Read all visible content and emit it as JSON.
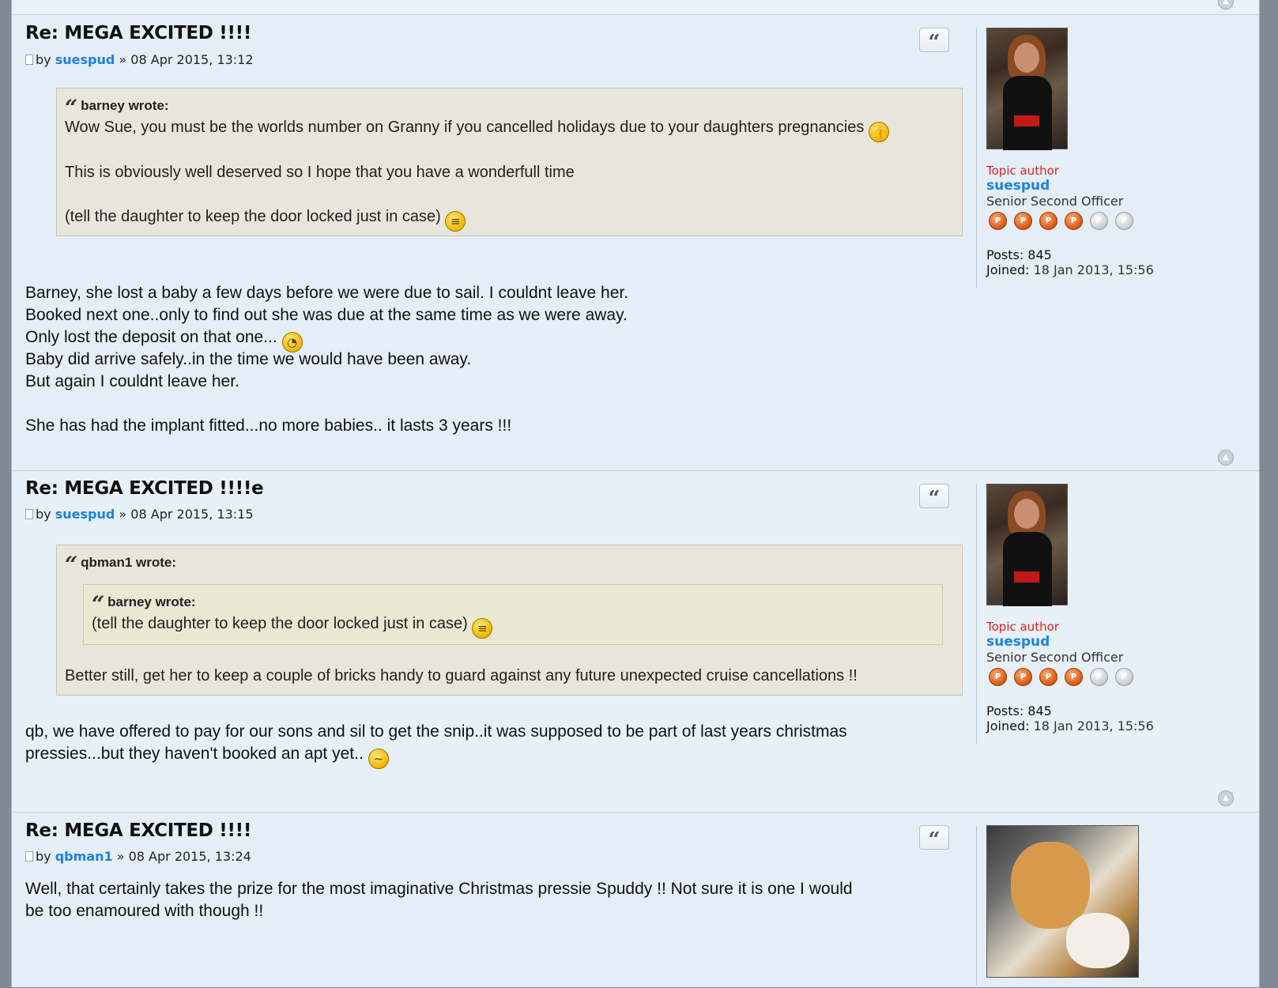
{
  "posts": [
    {
      "title": "Re: MEGA EXCITED !!!!",
      "by": "by",
      "author": "suespud",
      "date_sep": "»",
      "date": "08 Apr 2015, 13:12",
      "quote": {
        "author_line": "barney wrote:",
        "lines": [
          "Wow Sue, you must be the worlds number on Granny if you cancelled holidays due to your daughters pregnancies",
          "This is obviously well deserved so I hope that you have a wonderfull time",
          "(tell the daughter to keep the door locked just in case)"
        ]
      },
      "body": [
        "Barney, she lost a baby a few days before we were due to sail. I couldnt leave her.",
        "Booked next one..only to find out she was due at the same time as we were away.",
        "Only lost the deposit on that one...",
        "Baby did arrive safely..in the time we would have been away.",
        "But again I couldnt leave her.",
        "She has had the implant fitted...no more babies.. it lasts 3 years !!!"
      ],
      "sidebar": {
        "role": "Topic author",
        "name": "suespud",
        "rank": "Senior Second Officer",
        "posts_label": "Posts:",
        "posts": "845",
        "joined_label": "Joined:",
        "joined": "18 Jan 2013, 15:56"
      }
    },
    {
      "title": "Re: MEGA EXCITED !!!!e",
      "by": "by",
      "author": "suespud",
      "date_sep": "»",
      "date": "08 Apr 2015, 13:15",
      "quote": {
        "author_line": "qbman1 wrote:",
        "inner_author_line": "barney wrote:",
        "inner_line": "(tell the daughter to keep the door locked just in case)",
        "line": "Better still, get her to keep a couple of bricks handy to guard against any future unexpected cruise cancellations !!"
      },
      "body": [
        "qb, we have offered to pay for our sons and sil to get the snip..it was supposed to be part of last years christmas",
        "pressies...but they haven't booked an apt yet.."
      ],
      "sidebar": {
        "role": "Topic author",
        "name": "suespud",
        "rank": "Senior Second Officer",
        "posts_label": "Posts:",
        "posts": "845",
        "joined_label": "Joined:",
        "joined": "18 Jan 2013, 15:56"
      }
    },
    {
      "title": "Re: MEGA EXCITED !!!!",
      "by": "by",
      "author": "qbman1",
      "date_sep": "»",
      "date": "08 Apr 2015, 13:24",
      "body": [
        "Well, that certainly takes the prize for the most imaginative Christmas pressie Spuddy !! Not sure it is one I would",
        "be too enamoured with though !!"
      ]
    }
  ],
  "rank_level": {
    "filled": 4,
    "total": 6
  },
  "icons": {
    "quote": "quote-icon",
    "top": "back-to-top-icon",
    "smiley_thumbs": "thumbs-up-smiley-icon",
    "smiley_neutral": "neutral-smiley-icon",
    "smiley_rolleyes": "rolleyes-smiley-icon",
    "smiley_confused": "confused-smiley-icon"
  },
  "colors": {
    "link": "#1b82e0",
    "topic_author": "#e0201e",
    "quote_bg": "#e8e6dc",
    "post_bg": "#e5eef6"
  }
}
